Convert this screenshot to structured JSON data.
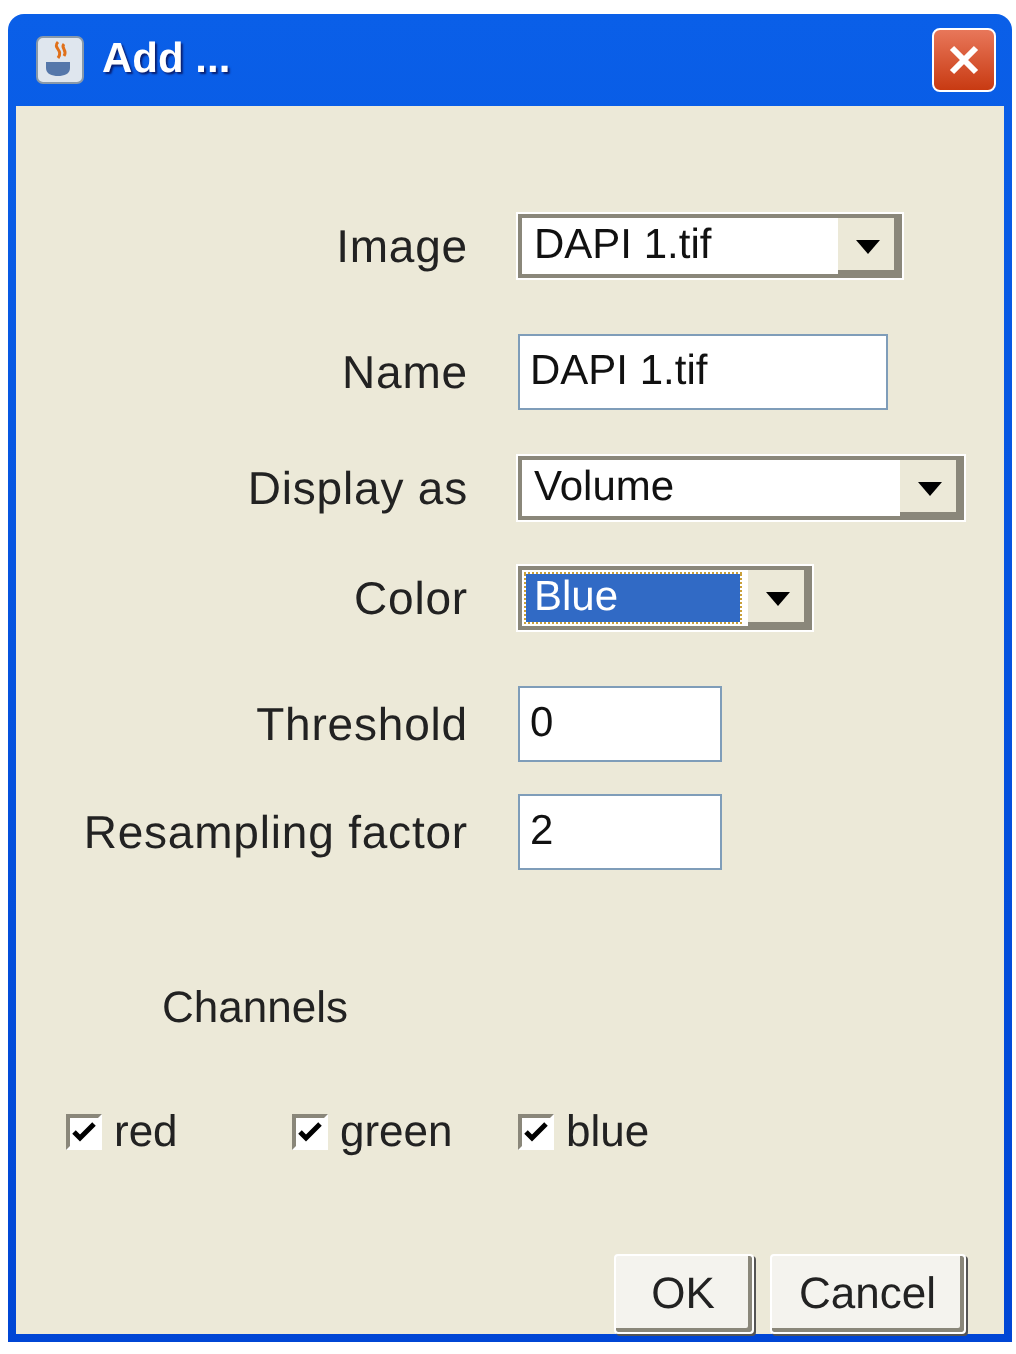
{
  "window": {
    "title": "Add ..."
  },
  "fields": [
    {
      "label": "Image",
      "kind": "combo",
      "value": "DAPI 1.tif",
      "focused": false
    },
    {
      "label": "Name",
      "kind": "text",
      "value": "DAPI 1.tif",
      "focused": false
    },
    {
      "label": "Display as",
      "kind": "combo",
      "value": "Volume",
      "focused": false
    },
    {
      "label": "Color",
      "kind": "combo",
      "value": "Blue",
      "focused": true
    },
    {
      "label": "Threshold",
      "kind": "text",
      "value": "0",
      "focused": false
    },
    {
      "label": "Resampling factor",
      "kind": "text",
      "value": "2",
      "focused": false
    }
  ],
  "channels": {
    "label": "Channels",
    "items": [
      {
        "label": "red",
        "checked": true
      },
      {
        "label": "green",
        "checked": true
      },
      {
        "label": "blue",
        "checked": true
      }
    ]
  },
  "buttons": [
    "OK",
    "Cancel"
  ]
}
